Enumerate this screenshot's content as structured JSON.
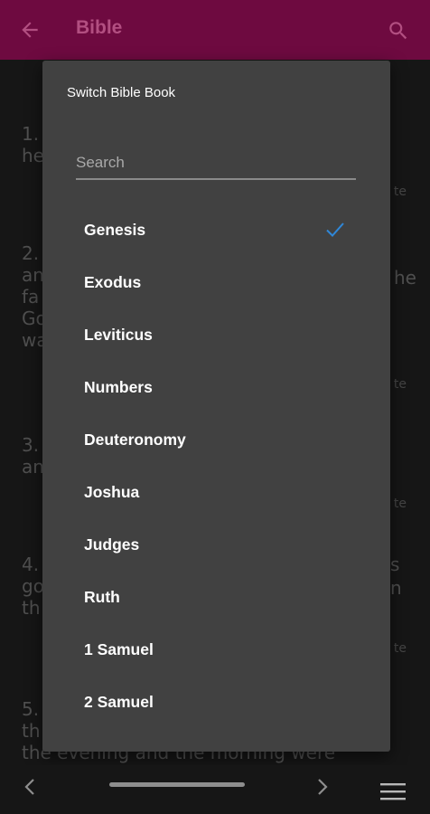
{
  "appbar": {
    "title": "Bible",
    "back_icon": "arrow-left-icon",
    "search_icon": "search-icon",
    "color": "#6e0a40"
  },
  "background": {
    "verses": [
      {
        "lines": [
          "1.",
          "he"
        ]
      },
      {
        "lines": [
          "2.",
          "an",
          "fa",
          "Go",
          "wa"
        ]
      },
      {
        "lines": [
          "3.",
          "an"
        ]
      },
      {
        "lines": [
          "4.",
          "go",
          "th"
        ]
      },
      {
        "lines": [
          "5.",
          "th",
          "the evening and the morning were"
        ]
      }
    ],
    "note_label": "te",
    "right_fragments": [
      "he",
      "s",
      "n"
    ]
  },
  "dialog": {
    "title": "Switch Bible Book",
    "search_placeholder": "Search",
    "books": [
      {
        "label": "Genesis",
        "selected": true
      },
      {
        "label": "Exodus",
        "selected": false
      },
      {
        "label": "Leviticus",
        "selected": false
      },
      {
        "label": "Numbers",
        "selected": false
      },
      {
        "label": "Deuteronomy",
        "selected": false
      },
      {
        "label": "Joshua",
        "selected": false
      },
      {
        "label": "Judges",
        "selected": false
      },
      {
        "label": "Ruth",
        "selected": false
      },
      {
        "label": "1 Samuel",
        "selected": false
      },
      {
        "label": "2 Samuel",
        "selected": false
      }
    ],
    "check_icon": "check-icon",
    "check_color": "#2f87d8"
  },
  "bottombar": {
    "prev_icon": "chevron-left-icon",
    "next_icon": "chevron-right-icon",
    "menu_icon": "hamburger-menu-icon"
  }
}
